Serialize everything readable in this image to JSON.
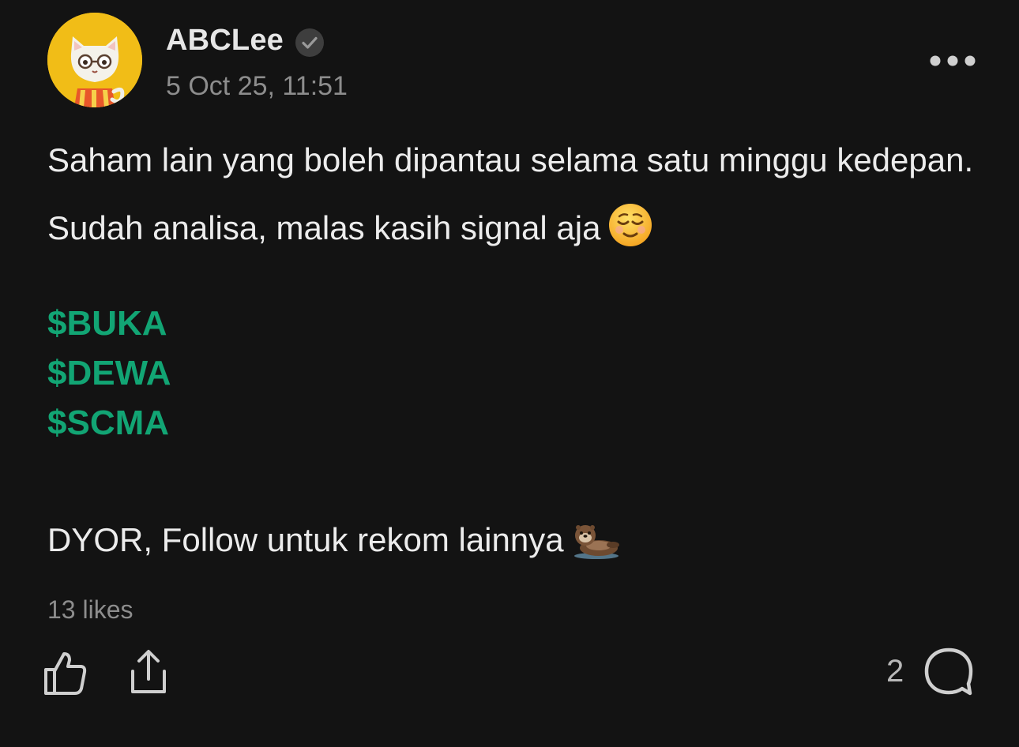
{
  "post": {
    "author": {
      "name": "ABCLee",
      "verified": true,
      "avatar_icon": "cat-with-glasses-avatar",
      "avatar_bg": "#f1bd17"
    },
    "timestamp": "5 Oct 25, 11:51",
    "more_icon": "more-dots-icon",
    "body_text": "Saham lain yang boleh dipantau selama satu minggu kedepan. Sudah analisa, malas kasih signal aja",
    "body_emoji": "relieved-face-emoji",
    "tickers": [
      "$BUKA",
      "$DEWA",
      "$SCMA"
    ],
    "ticker_color": "#12a574",
    "footer_text": "DYOR, Follow untuk rekom lainnya",
    "footer_emoji": "otter-emoji",
    "likes_text": "13 likes",
    "comment_count": "2"
  },
  "colors": {
    "background": "#131313",
    "primary_text": "#ececec",
    "secondary_text": "#8d8d8d"
  }
}
